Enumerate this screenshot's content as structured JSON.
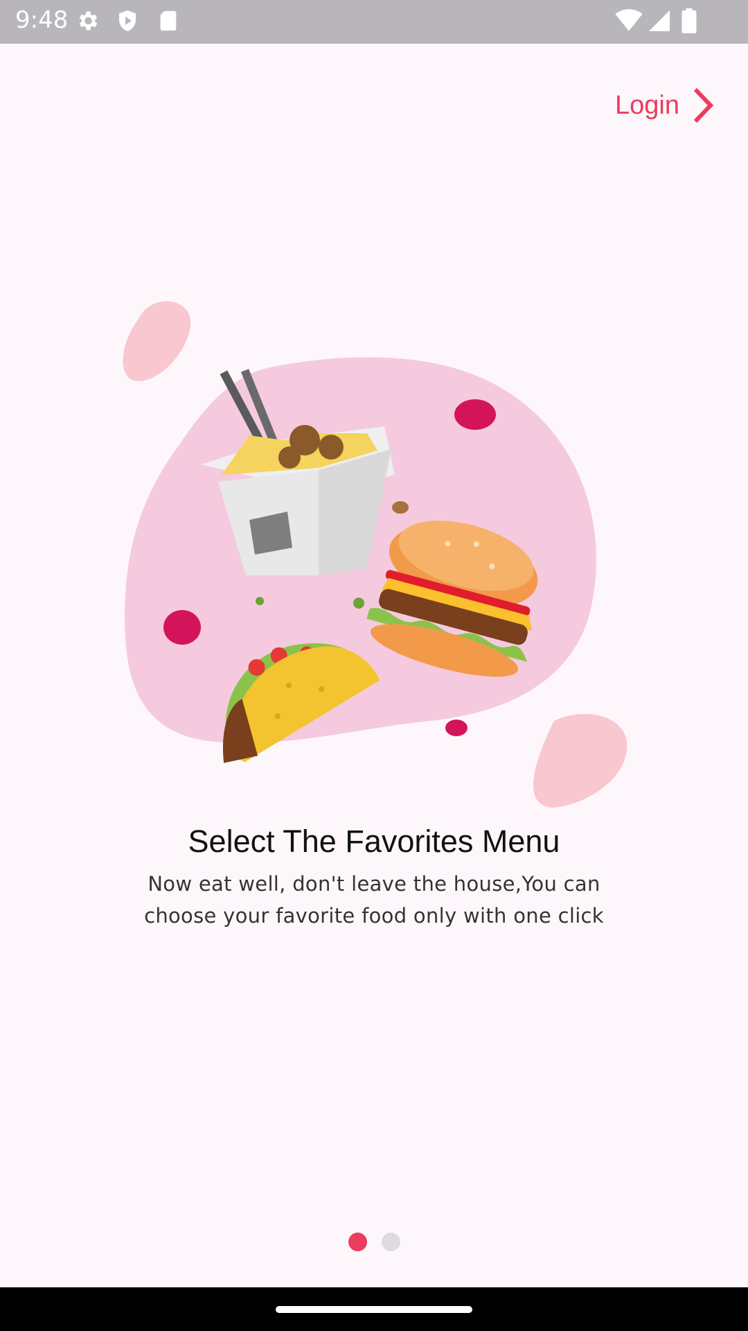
{
  "status_bar": {
    "time": "9:48",
    "icons": [
      "settings-icon",
      "shield-icon",
      "sd-card-icon",
      "wifi-icon",
      "cellular-signal-icon",
      "battery-icon"
    ]
  },
  "header": {
    "login_label": "Login",
    "login_icon": "chevron-right-icon",
    "accent_color": "#ea3c5e"
  },
  "onboarding": {
    "illustration": "food-illustration",
    "title": "Select The Favorites Menu",
    "description_line1": "Now eat well, don't leave the house,You can",
    "description_line2": "choose your favorite food only with one click"
  },
  "pager": {
    "page_count": 2,
    "active_index": 0,
    "active_color": "#ea3c5e",
    "inactive_color": "#dedbe0"
  }
}
